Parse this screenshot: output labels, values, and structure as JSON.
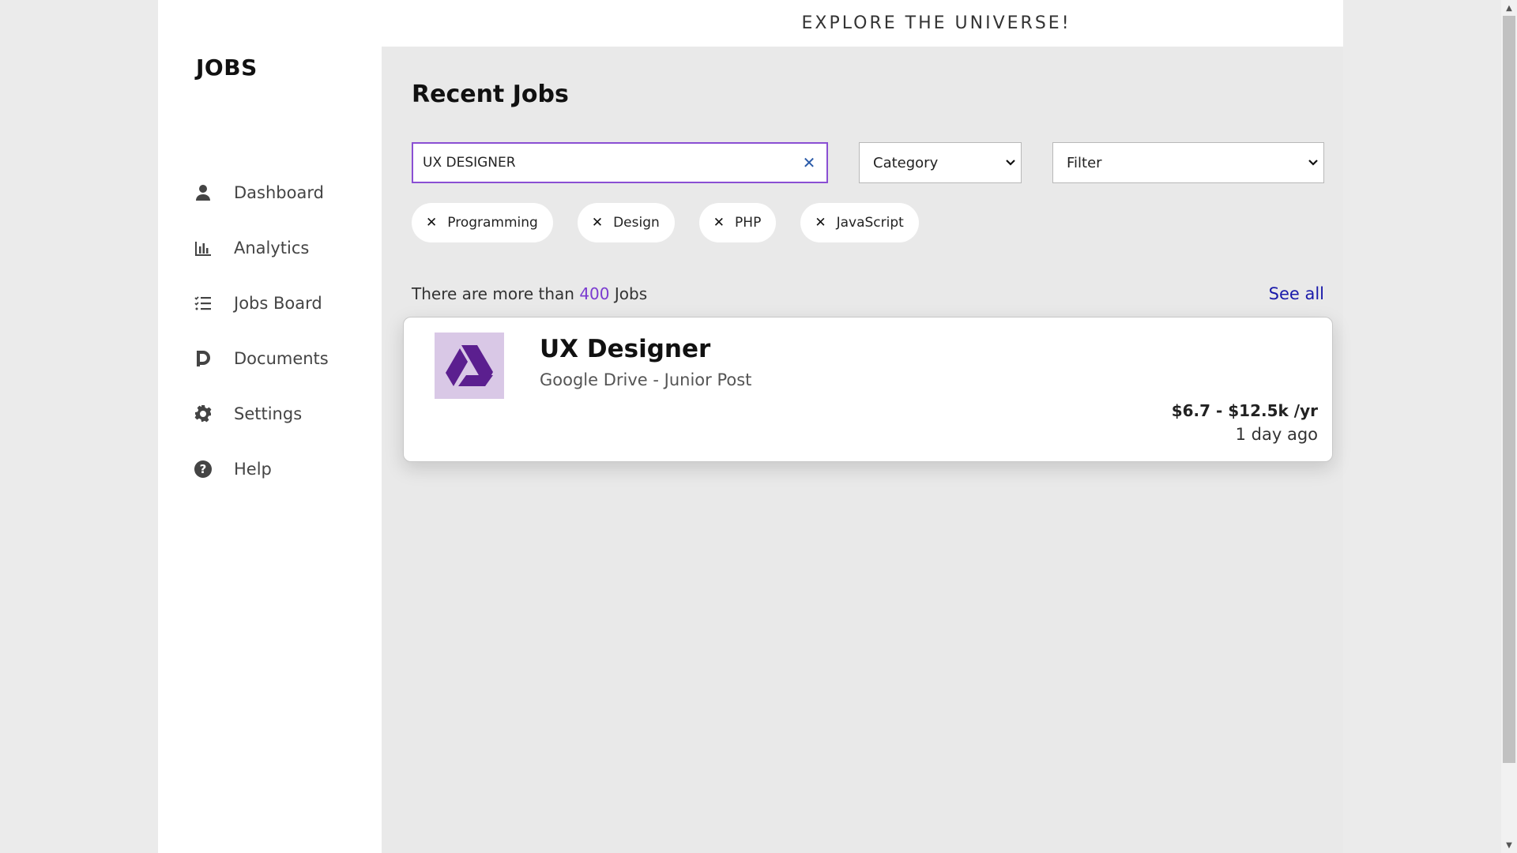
{
  "topbar": {
    "title": "EXPLORE THE UNIVERSE!"
  },
  "sidebar": {
    "logo": "JOBS",
    "items": [
      {
        "label": "Dashboard",
        "icon": "user-icon"
      },
      {
        "label": "Analytics",
        "icon": "bar-chart-icon"
      },
      {
        "label": "Jobs Board",
        "icon": "list-icon"
      },
      {
        "label": "Documents",
        "icon": "document-icon"
      },
      {
        "label": "Settings",
        "icon": "gear-icon"
      },
      {
        "label": "Help",
        "icon": "help-icon"
      }
    ]
  },
  "main": {
    "title": "Recent Jobs",
    "search": {
      "value": "UX DESIGNER",
      "placeholder": ""
    },
    "category_select": {
      "selected": "Category"
    },
    "filter_select": {
      "selected": "Filter"
    },
    "chips": [
      {
        "label": "Programming"
      },
      {
        "label": "Design"
      },
      {
        "label": "PHP"
      },
      {
        "label": "JavaScript"
      }
    ],
    "count": {
      "prefix": "There are more than ",
      "number": "400",
      "suffix": " Jobs"
    },
    "see_all": "See all",
    "job": {
      "title": "UX Designer",
      "company": "Google Drive - Junior Post",
      "salary": "$6.7 - $12.5k /yr",
      "posted": "1 day ago",
      "logo_icon": "google-drive-icon"
    }
  },
  "colors": {
    "accent": "#7a3bd0",
    "logo_bg": "#d9c8e6",
    "logo_fg": "#5b1f8f",
    "link": "#1a1aaa"
  }
}
